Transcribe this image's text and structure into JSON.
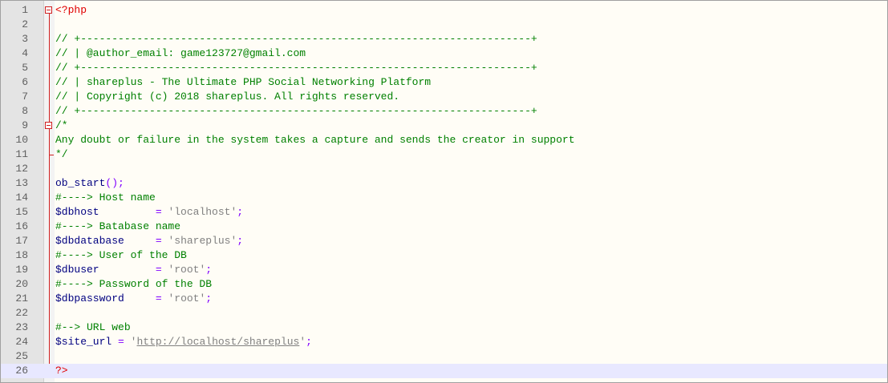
{
  "editor": {
    "lines": [
      {
        "n": "1",
        "t": [
          {
            "c": "phpdelim",
            "v": "<?php"
          }
        ]
      },
      {
        "n": "2",
        "t": []
      },
      {
        "n": "3",
        "t": [
          {
            "c": "comment",
            "v": "// +------------------------------------------------------------------------+"
          }
        ]
      },
      {
        "n": "4",
        "t": [
          {
            "c": "comment",
            "v": "// | @author_email: game123727@gmail.com"
          }
        ]
      },
      {
        "n": "5",
        "t": [
          {
            "c": "comment",
            "v": "// +------------------------------------------------------------------------+"
          }
        ]
      },
      {
        "n": "6",
        "t": [
          {
            "c": "comment",
            "v": "// | shareplus - The Ultimate PHP Social Networking Platform"
          }
        ]
      },
      {
        "n": "7",
        "t": [
          {
            "c": "comment",
            "v": "// | Copyright (c) 2018 shareplus. All rights reserved."
          }
        ]
      },
      {
        "n": "8",
        "t": [
          {
            "c": "comment",
            "v": "// +------------------------------------------------------------------------+"
          }
        ]
      },
      {
        "n": "9",
        "t": [
          {
            "c": "comment",
            "v": "/*"
          }
        ]
      },
      {
        "n": "10",
        "t": [
          {
            "c": "comment",
            "v": "Any doubt or failure in the system takes a capture and sends the creator in support"
          }
        ]
      },
      {
        "n": "11",
        "t": [
          {
            "c": "comment",
            "v": "*/"
          }
        ]
      },
      {
        "n": "12",
        "t": []
      },
      {
        "n": "13",
        "t": [
          {
            "c": "func",
            "v": "ob_start"
          },
          {
            "c": "op",
            "v": "();"
          }
        ]
      },
      {
        "n": "14",
        "t": [
          {
            "c": "comment",
            "v": "#----> Host name"
          }
        ]
      },
      {
        "n": "15",
        "t": [
          {
            "c": "var",
            "v": "$dbhost"
          },
          {
            "c": "",
            "v": "         "
          },
          {
            "c": "op",
            "v": "="
          },
          {
            "c": "",
            "v": " "
          },
          {
            "c": "str",
            "v": "'localhost'"
          },
          {
            "c": "op",
            "v": ";"
          }
        ]
      },
      {
        "n": "16",
        "t": [
          {
            "c": "comment",
            "v": "#----> Batabase name"
          }
        ]
      },
      {
        "n": "17",
        "t": [
          {
            "c": "var",
            "v": "$dbdatabase"
          },
          {
            "c": "",
            "v": "     "
          },
          {
            "c": "op",
            "v": "="
          },
          {
            "c": "",
            "v": " "
          },
          {
            "c": "str",
            "v": "'shareplus'"
          },
          {
            "c": "op",
            "v": ";"
          }
        ]
      },
      {
        "n": "18",
        "t": [
          {
            "c": "comment",
            "v": "#----> User of the DB"
          }
        ]
      },
      {
        "n": "19",
        "t": [
          {
            "c": "var",
            "v": "$dbuser"
          },
          {
            "c": "",
            "v": "         "
          },
          {
            "c": "op",
            "v": "="
          },
          {
            "c": "",
            "v": " "
          },
          {
            "c": "str",
            "v": "'root'"
          },
          {
            "c": "op",
            "v": ";"
          }
        ]
      },
      {
        "n": "20",
        "t": [
          {
            "c": "comment",
            "v": "#----> Password of the DB"
          }
        ]
      },
      {
        "n": "21",
        "t": [
          {
            "c": "var",
            "v": "$dbpassword"
          },
          {
            "c": "",
            "v": "     "
          },
          {
            "c": "op",
            "v": "="
          },
          {
            "c": "",
            "v": " "
          },
          {
            "c": "str",
            "v": "'root'"
          },
          {
            "c": "op",
            "v": ";"
          }
        ]
      },
      {
        "n": "22",
        "t": []
      },
      {
        "n": "23",
        "t": [
          {
            "c": "comment",
            "v": "#--> URL web"
          }
        ]
      },
      {
        "n": "24",
        "t": [
          {
            "c": "var",
            "v": "$site_url"
          },
          {
            "c": "",
            "v": " "
          },
          {
            "c": "op",
            "v": "="
          },
          {
            "c": "",
            "v": " "
          },
          {
            "c": "str",
            "v": "'"
          },
          {
            "c": "url",
            "v": "http://localhost/shareplus"
          },
          {
            "c": "str",
            "v": "'"
          },
          {
            "c": "op",
            "v": ";"
          }
        ]
      },
      {
        "n": "25",
        "t": []
      },
      {
        "n": "26",
        "t": [
          {
            "c": "phpdelim",
            "v": "?>"
          }
        ],
        "current": true
      }
    ]
  },
  "colors": {
    "comment": "#008000",
    "php_delimiter": "#e00000",
    "variable": "#000080",
    "operator": "#8000ff",
    "string": "#808080",
    "current_line": "#e8e8ff",
    "fold_marker": "#d02020"
  },
  "icons": {
    "fold_markers": [
      "fold-collapse-icon",
      "fold-collapse-icon"
    ]
  }
}
